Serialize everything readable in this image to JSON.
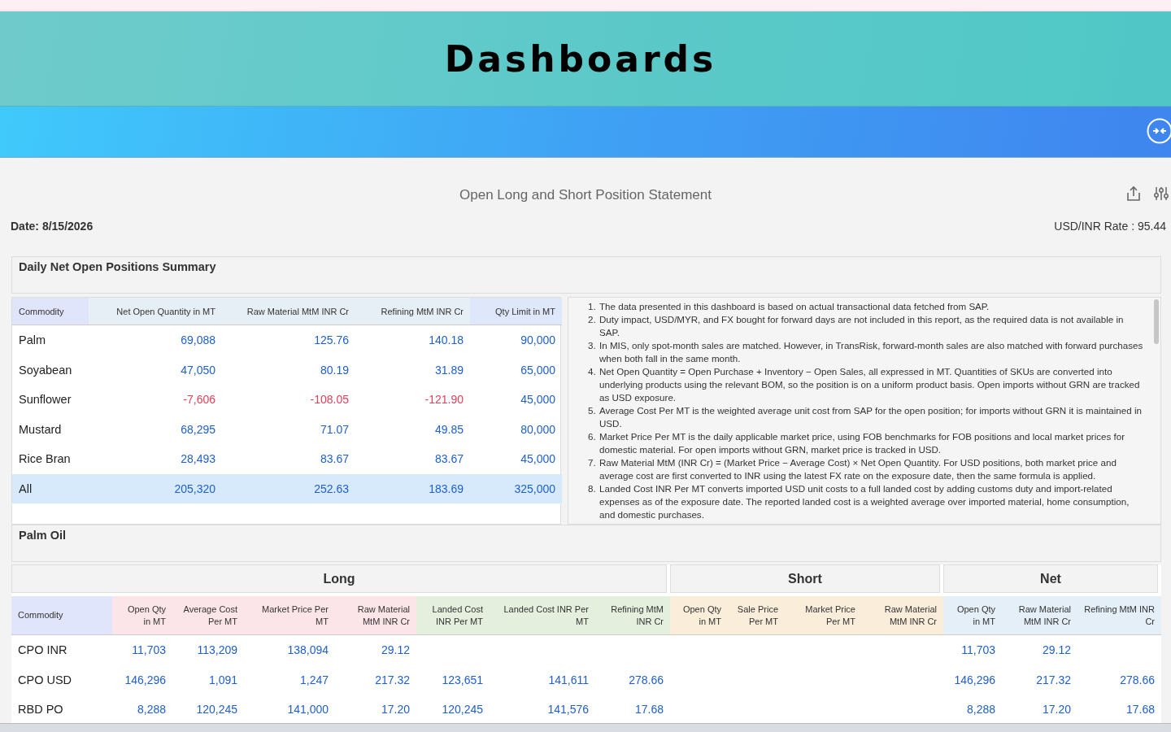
{
  "header": {
    "title": "Dashboards"
  },
  "statement": {
    "title": "Open Long and Short Position Statement",
    "date": "Date: 8/15/2026",
    "rate": "USD/INR Rate : 95.44"
  },
  "summary": {
    "title": "Daily Net Open Positions Summary",
    "columns": [
      {
        "label": "Commodity",
        "color": "#e1e5fb"
      },
      {
        "label": "Net Open Quantity in MT",
        "color": "#e7eff6"
      },
      {
        "label": "Raw Material MtM INR Cr",
        "color": "#e7eff6"
      },
      {
        "label": "Refining MtM INR Cr",
        "color": "#e7eff6"
      },
      {
        "label": "Qty Limit in MT",
        "color": "#dfe7fa"
      }
    ],
    "rows": [
      {
        "highlighted": false,
        "cells": [
          {
            "text": "Palm",
            "negative": false
          },
          {
            "text": "69,088",
            "negative": false
          },
          {
            "text": "125.76",
            "negative": false
          },
          {
            "text": "140.18",
            "negative": false
          },
          {
            "text": "90,000",
            "negative": false
          }
        ]
      },
      {
        "highlighted": false,
        "cells": [
          {
            "text": "Soyabean",
            "negative": false
          },
          {
            "text": "47,050",
            "negative": false
          },
          {
            "text": "80.19",
            "negative": false
          },
          {
            "text": "31.89",
            "negative": false
          },
          {
            "text": "65,000",
            "negative": false
          }
        ]
      },
      {
        "highlighted": false,
        "cells": [
          {
            "text": "Sunflower",
            "negative": false
          },
          {
            "text": "-7,606",
            "negative": true
          },
          {
            "text": "-108.05",
            "negative": true
          },
          {
            "text": "-121.90",
            "negative": true
          },
          {
            "text": "45,000",
            "negative": false
          }
        ]
      },
      {
        "highlighted": false,
        "cells": [
          {
            "text": "Mustard",
            "negative": false
          },
          {
            "text": "68,295",
            "negative": false
          },
          {
            "text": "71.07",
            "negative": false
          },
          {
            "text": "49.85",
            "negative": false
          },
          {
            "text": "80,000",
            "negative": false
          }
        ]
      },
      {
        "highlighted": false,
        "cells": [
          {
            "text": "Rice Bran",
            "negative": false
          },
          {
            "text": "28,493",
            "negative": false
          },
          {
            "text": "83.67",
            "negative": false
          },
          {
            "text": "83.67",
            "negative": false
          },
          {
            "text": "45,000",
            "negative": false
          }
        ]
      },
      {
        "highlighted": true,
        "cells": [
          {
            "text": "All",
            "negative": false
          },
          {
            "text": "205,320",
            "negative": false
          },
          {
            "text": "252.63",
            "negative": false
          },
          {
            "text": "183.69",
            "negative": false
          },
          {
            "text": "325,000",
            "negative": false
          }
        ]
      }
    ],
    "notes": [
      {
        "number": "1.",
        "text": "The data presented in this dashboard is based on actual transactional data fetched from SAP."
      },
      {
        "number": "2.",
        "text": "Duty impact, USD/MYR, and FX bought for forward days are not included in this report, as the required data is not available in SAP."
      },
      {
        "number": "3.",
        "text": "In MIS, only spot-month sales are matched. However, in TransRisk, forward-month sales are also matched with forward purchases when both fall in the same month."
      },
      {
        "number": "4.",
        "text": "Net Open Quantity = Open Purchase + Inventory − Open Sales, all expressed in MT. Quantities of SKUs are converted into underlying products using the relevant BOM, so the position is on a uniform product basis. Open imports without GRN are tracked as USD exposure."
      },
      {
        "number": "5.",
        "text": "Average Cost Per MT is the weighted average unit cost from SAP for the open position; for imports without GRN it is maintained in USD."
      },
      {
        "number": "6.",
        "text": "Market Price Per MT is the daily applicable market price, using FOB benchmarks for FOB positions and local market prices for domestic material. For open imports without GRN, market price is tracked in USD."
      },
      {
        "number": "7.",
        "text": "Raw Material MtM (INR Cr) = (Market Price − Average Cost) × Net Open Quantity. For USD positions, both market price and average cost are first converted to INR using the latest FX rate on the exposure date, then the same formula is applied."
      },
      {
        "number": "8.",
        "text": "Landed Cost INR Per MT converts imported USD unit costs to a full landed cost by adding customs duty and import-related expenses as of the exposure date. The reported landed cost is a weighted average over imported material, home consumption, and domestic purchases."
      }
    ]
  },
  "palm": {
    "title": "Palm Oil",
    "groups": [
      {
        "label": "Long",
        "columns": [
          {
            "label": "Commodity",
            "color": "#e1e5fb"
          },
          {
            "label": "Open Qty in MT",
            "color": "#fce5e9"
          },
          {
            "label": "Average Cost Per MT",
            "color": "#fce5e9"
          },
          {
            "label": "Market Price Per MT",
            "color": "#fce5e9"
          },
          {
            "label": "Raw Material MtM INR Cr",
            "color": "#fce5e9"
          },
          {
            "label": "Landed Cost INR Per MT",
            "color": "#e4f0dd"
          },
          {
            "label": "Landed Cost INR Per MT",
            "color": "#e4f0dd"
          },
          {
            "label": "Refining MtM INR Cr",
            "color": "#e4f0dd"
          }
        ]
      },
      {
        "label": "Short",
        "columns": [
          {
            "label": "Open Qty in MT",
            "color": "#faedd9"
          },
          {
            "label": "Sale Price Per MT",
            "color": "#faedd9"
          },
          {
            "label": "Market Price Per MT",
            "color": "#faedd9"
          },
          {
            "label": "Raw Material MtM INR Cr",
            "color": "#faedd9"
          }
        ]
      },
      {
        "label": "Net",
        "columns": [
          {
            "label": "Open Qty in MT",
            "color": "#e4eff8"
          },
          {
            "label": "Raw Material MtM INR Cr",
            "color": "#e4eff8"
          },
          {
            "label": "Refining MtM INR Cr",
            "color": "#e4eff8"
          }
        ]
      }
    ],
    "rows": [
      [
        "CPO INR",
        "11,703",
        "113,209",
        "138,094",
        "29.12",
        null,
        null,
        null,
        null,
        null,
        null,
        null,
        "11,703",
        "29.12",
        null
      ],
      [
        "CPO USD",
        "146,296",
        "1,091",
        "1,247",
        "217.32",
        "123,651",
        "141,611",
        "278.66",
        null,
        null,
        null,
        null,
        "146,296",
        "217.32",
        "278.66"
      ],
      [
        "RBD PO",
        "8,288",
        "120,245",
        "141,000",
        "17.20",
        "120,245",
        "141,576",
        "17.68",
        null,
        null,
        null,
        null,
        "8,288",
        "17.20",
        "17.68"
      ]
    ]
  }
}
